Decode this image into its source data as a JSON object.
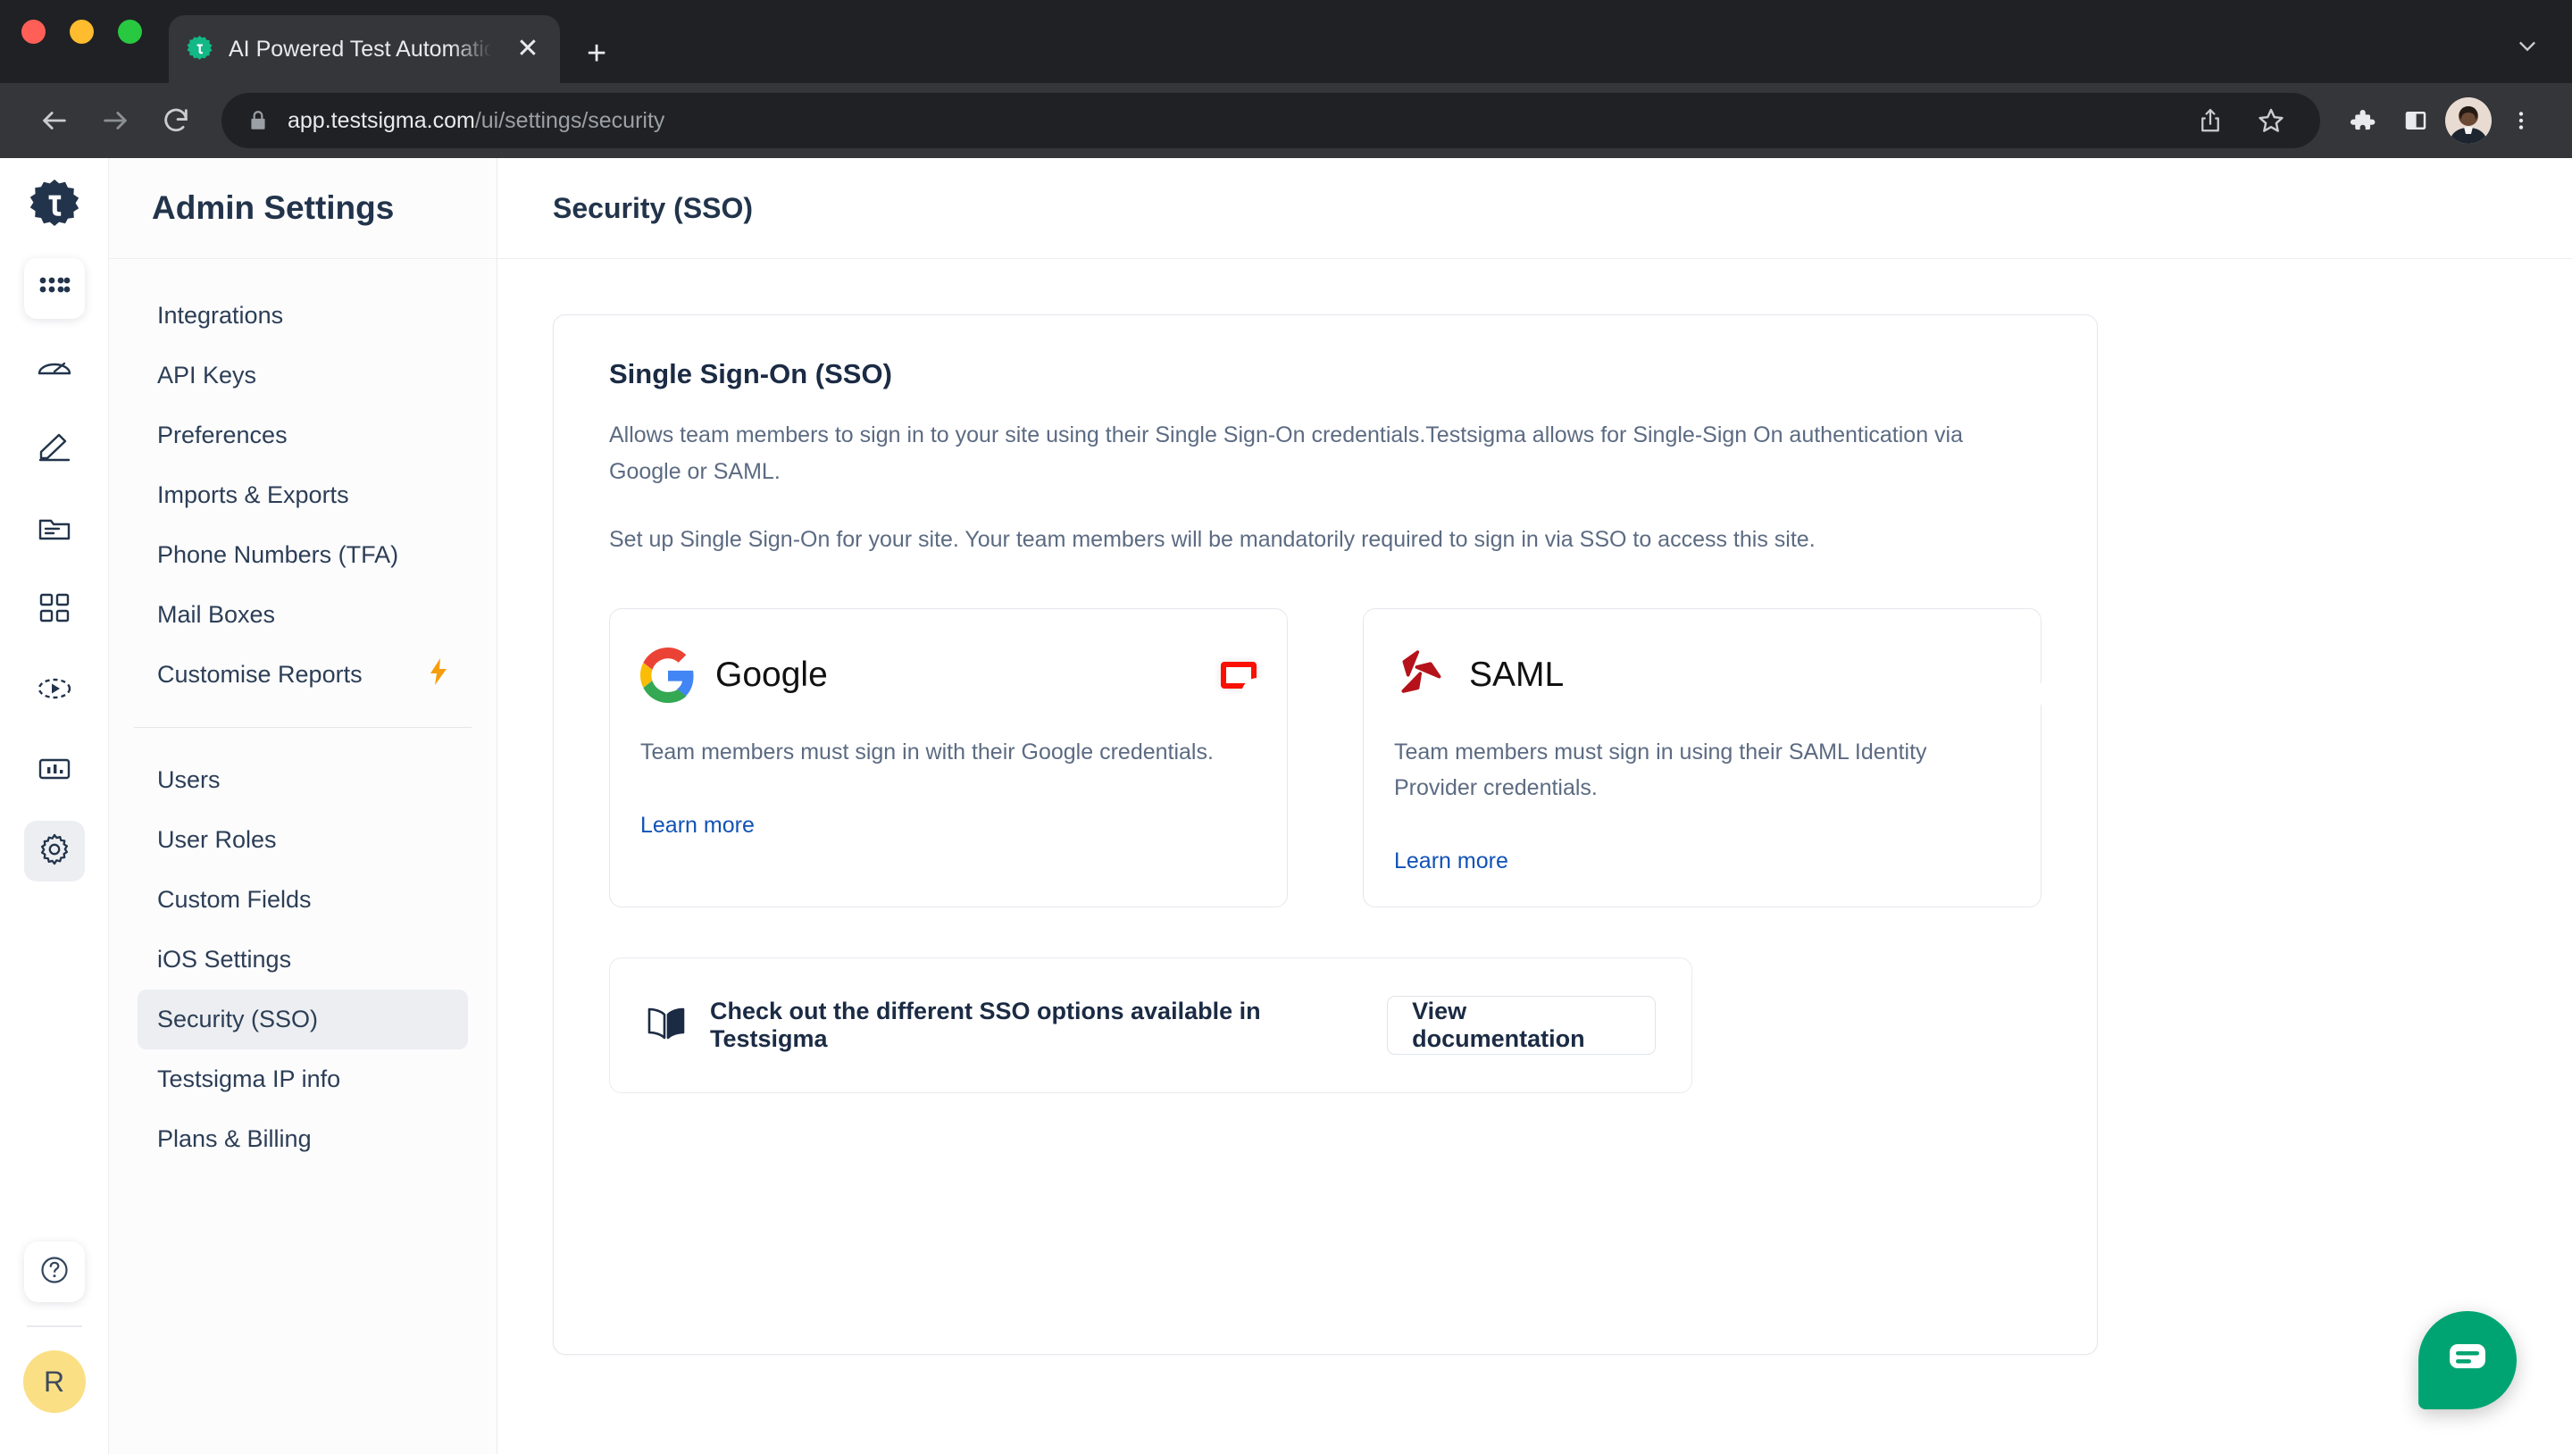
{
  "browser": {
    "tab": {
      "title": "AI Powered Test Automation Pl",
      "favicon_icon": "testsigma-gear-icon",
      "close_icon": "close-icon",
      "new_tab_icon": "plus-icon",
      "tab_list_icon": "chevron-down-icon"
    },
    "toolbar": {
      "back_icon": "back-arrow-icon",
      "forward_icon": "forward-arrow-icon",
      "reload_icon": "reload-icon",
      "lock_icon": "lock-icon",
      "url_host": "app.testsigma.com",
      "url_path": "/ui/settings/security",
      "share_icon": "share-icon",
      "bookmark_icon": "star-icon",
      "extensions_icon": "puzzle-piece-icon",
      "side_panel_icon": "side-panel-icon",
      "profile_icon": "profile-avatar",
      "menu_icon": "three-dot-menu-icon"
    }
  },
  "rail": {
    "logo_icon": "testsigma-logo",
    "items": [
      {
        "icon": "grid-apps-icon",
        "name": "apps"
      },
      {
        "icon": "dashboard-speedometer-icon",
        "name": "dashboard"
      },
      {
        "icon": "pencil-create-icon",
        "name": "create-tests"
      },
      {
        "icon": "folder-icon",
        "name": "test-data"
      },
      {
        "icon": "four-squares-icon",
        "name": "test-suites"
      },
      {
        "icon": "run-play-icon",
        "name": "test-runs"
      },
      {
        "icon": "bar-chart-icon",
        "name": "reports"
      },
      {
        "icon": "gear-icon",
        "name": "settings"
      }
    ],
    "help_icon": "question-mark-icon",
    "avatar_initial": "R"
  },
  "settings_nav": {
    "title": "Admin Settings",
    "group_one": [
      {
        "label": "Integrations"
      },
      {
        "label": "API Keys"
      },
      {
        "label": "Preferences"
      },
      {
        "label": "Imports & Exports"
      },
      {
        "label": "Phone Numbers (TFA)"
      },
      {
        "label": "Mail Boxes"
      },
      {
        "label": "Customise Reports",
        "badge_icon": "lightning-bolt-icon"
      }
    ],
    "group_two": [
      {
        "label": "Users"
      },
      {
        "label": "User Roles"
      },
      {
        "label": "Custom Fields"
      },
      {
        "label": "iOS Settings"
      },
      {
        "label": "Security (SSO)"
      },
      {
        "label": "Testsigma IP info"
      },
      {
        "label": "Plans & Billing"
      }
    ],
    "active_label": "Security (SSO)"
  },
  "content": {
    "header_title": "Security (SSO)",
    "sso": {
      "title": "Single Sign-On (SSO)",
      "paragraph_1": "Allows team members to sign in to your site using their Single Sign-On credentials.Testsigma allows for Single-Sign On authentication via Google or SAML.",
      "paragraph_2": "Set up Single Sign-On for your site. Your team members will be mandatorily required to sign in via SSO to access this site."
    },
    "providers": [
      {
        "name": "Google",
        "logo_icon": "google-logo-icon",
        "description": "Team members must sign in with their Google credentials.",
        "learn_more_label": "Learn more",
        "toggle_on": false,
        "highlighted": true
      },
      {
        "name": "SAML",
        "logo_icon": "saml-logo-icon",
        "description": "Team members must sign in using their SAML Identity Provider credentials.",
        "learn_more_label": "Learn more",
        "toggle_on": false,
        "highlighted": false
      }
    ],
    "doc_banner": {
      "icon": "open-book-icon",
      "text": "Check out the different SSO options available in Testsigma",
      "button_label": "View documentation"
    },
    "chat_icon": "chat-bubble-icon"
  },
  "colors": {
    "accent_link": "#1152b5",
    "brand_dark": "#22344b",
    "toggle_off": "#66758d",
    "highlight_red": "#fa0f00",
    "chat_green": "#00a472",
    "avatar_yellow": "#fadf85",
    "bolt_orange": "#f59e0b"
  }
}
